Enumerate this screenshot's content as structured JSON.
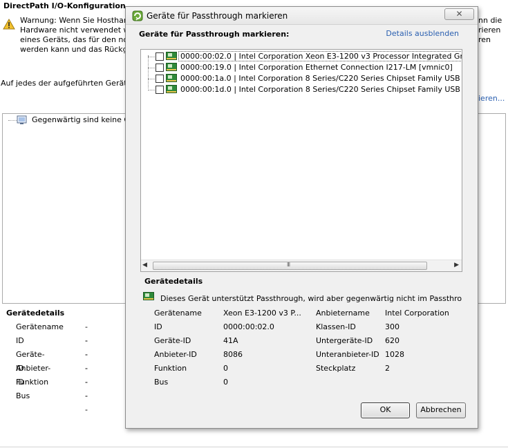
{
  "background": {
    "title": "DirectPath I/O-Konfiguration",
    "warning_lines": [
      "Warnung: Wenn Sie Hosthardwa",
      "Hardware nicht verwendet werd",
      "eines Geräts, das für den norma",
      "werden kann und das Rückgäng"
    ],
    "warning_right_lines": [
      "nn die",
      "rieren",
      "ren"
    ],
    "instruction": "Auf jedes der aufgeführten Geräte ka",
    "right_link": "ieren...",
    "empty_message": "Gegenwärtig sind keine Ger",
    "details_title": "Gerätedetails",
    "details_rows": [
      {
        "label": "Gerätename",
        "value": "--"
      },
      {
        "label": "ID",
        "value": "--"
      },
      {
        "label": "Geräte-ID",
        "value": "--"
      },
      {
        "label": "Anbieter-ID",
        "value": "--"
      },
      {
        "label": "Funktion",
        "value": "--"
      },
      {
        "label": "Bus",
        "value": "--"
      }
    ]
  },
  "dialog": {
    "title": "Geräte für Passthrough markieren",
    "close_symbol": "✕",
    "header": "Geräte für Passthrough markieren:",
    "details_link": "Details ausblenden",
    "devices": [
      {
        "text": "0000:00:02.0 | Intel Corporation Xeon E3-1200 v3 Processor Integrated Graphics",
        "checked": false,
        "selected": true
      },
      {
        "text": "0000:00:19.0 | Intel Corporation Ethernet Connection I217-LM [vmnic0]",
        "checked": false,
        "selected": false
      },
      {
        "text": "0000:00:1a.0 | Intel Corporation 8 Series/C220 Series Chipset Family USB EHCI #",
        "checked": false,
        "selected": false
      },
      {
        "text": "0000:00:1d.0 | Intel Corporation 8 Series/C220 Series Chipset Family USB EHCI #",
        "checked": false,
        "selected": false
      }
    ],
    "scroll_grip": "III",
    "details_title": "Gerätedetails",
    "details_message": "Dieses Gerät unterstützt Passthrough, wird aber gegenwärtig nicht im Passthrough-Modus a",
    "left_details": [
      {
        "label": "Gerätename",
        "value": "Xeon E3-1200 v3 P..."
      },
      {
        "label": "ID",
        "value": "0000:00:02.0"
      },
      {
        "label": "Geräte-ID",
        "value": "41A"
      },
      {
        "label": "Anbieter-ID",
        "value": "8086"
      },
      {
        "label": "Funktion",
        "value": "0"
      },
      {
        "label": "Bus",
        "value": "0"
      }
    ],
    "right_details": [
      {
        "label": "Anbietername",
        "value": "Intel Corporation"
      },
      {
        "label": "Klassen-ID",
        "value": "300"
      },
      {
        "label": "Untergeräte-ID",
        "value": "620"
      },
      {
        "label": "Unteranbieter-ID",
        "value": "1028"
      },
      {
        "label": "Steckplatz",
        "value": "2"
      }
    ],
    "ok_label": "OK",
    "cancel_label": "Abbrechen"
  },
  "colors": {
    "link": "#2a5fb0",
    "dialog_bg": "#f0f0f0",
    "warning": "#f2c12e"
  }
}
